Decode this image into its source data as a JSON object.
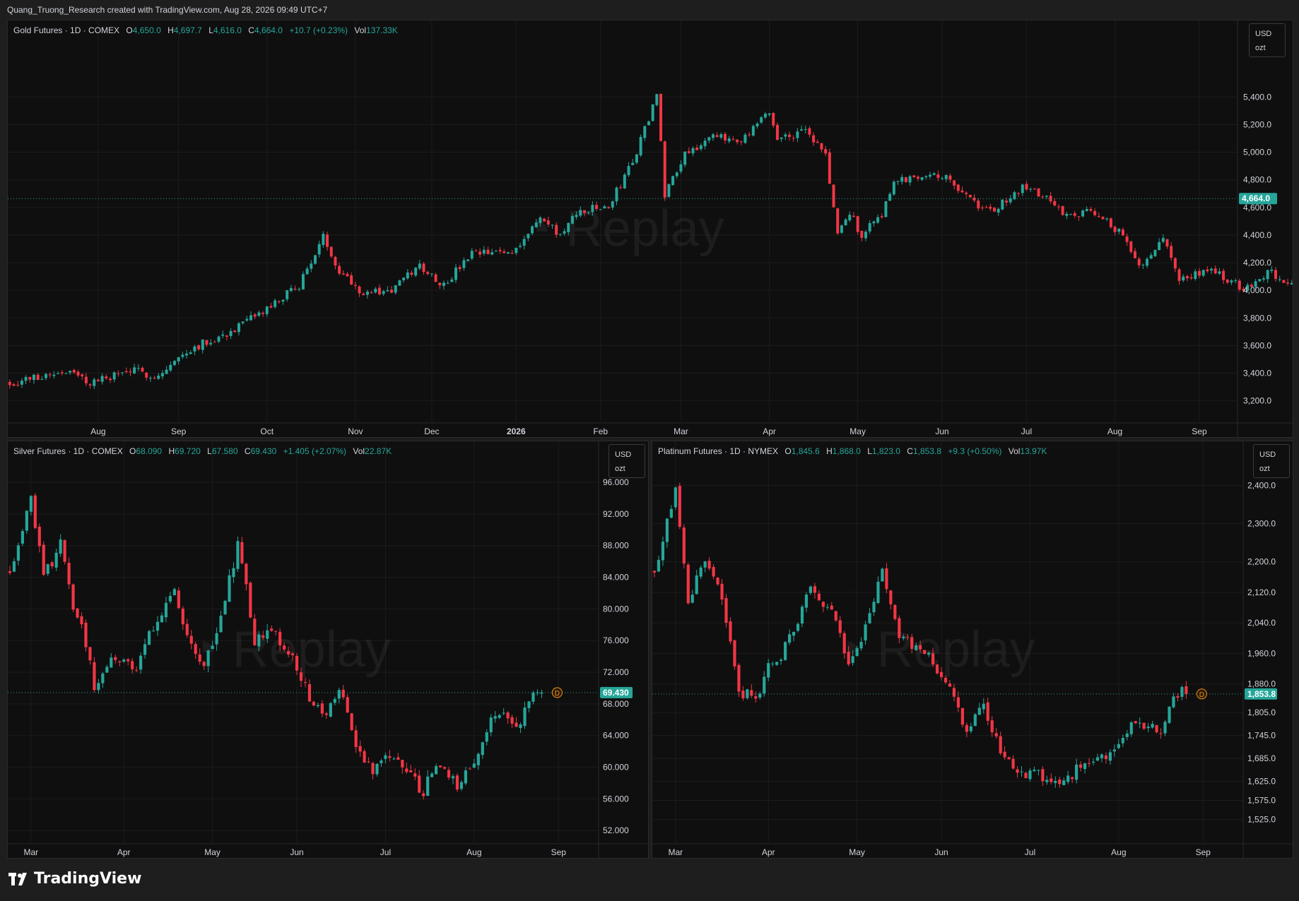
{
  "header": {
    "credit": "Quang_Truong_Research created with TradingView.com, Aug 28, 2026 09:49 UTC+7"
  },
  "footer": {
    "brand": "TradingView"
  },
  "colors": {
    "up": "#26a69a",
    "down": "#f23645",
    "background": "#0f0f0f",
    "grid": "#1c1c1c",
    "marker": "#f7931a"
  },
  "chart_data": [
    {
      "id": "gold",
      "type": "candlestick",
      "title": "Gold Futures · 1D · COMEX",
      "ohlc": {
        "o": "4,650.0",
        "h": "4,697.7",
        "l": "4,616.0",
        "c": "4,664.0",
        "chg": "+10.7 (+0.23%)",
        "vol": "137.33K"
      },
      "unit_box": [
        "USD",
        "ozt"
      ],
      "last_price": "4,664.0",
      "last_value": 4664,
      "ylim": [
        3050,
        5800
      ],
      "y_ticks": [
        {
          "v": 3200,
          "t": "3,200.0"
        },
        {
          "v": 3400,
          "t": "3,400.0"
        },
        {
          "v": 3600,
          "t": "3,600.0"
        },
        {
          "v": 3800,
          "t": "3,800.0"
        },
        {
          "v": 4000,
          "t": "4,000.0"
        },
        {
          "v": 4200,
          "t": "4,200.0"
        },
        {
          "v": 4400,
          "t": "4,400.0"
        },
        {
          "v": 4600,
          "t": "4,600.0"
        },
        {
          "v": 4800,
          "t": "4,800.0"
        },
        {
          "v": 5000,
          "t": "5,000.0"
        },
        {
          "v": 5200,
          "t": "5,200.0"
        },
        {
          "v": 5400,
          "t": "5,400.0"
        }
      ],
      "x_ticks": [
        "Aug",
        "Sep",
        "Oct",
        "Nov",
        "Dec",
        "2026",
        "Feb",
        "Mar",
        "Apr",
        "May",
        "Jun",
        "Jul",
        "Aug",
        "Sep"
      ],
      "x_tick_index": [
        22,
        42,
        64,
        86,
        105,
        126,
        147,
        167,
        189,
        211,
        232,
        253,
        275,
        296
      ],
      "n_slots": 306,
      "series": [
        [
          0,
          3330
        ],
        [
          14,
          3420
        ],
        [
          20,
          3330
        ],
        [
          30,
          3420
        ],
        [
          37,
          3380
        ],
        [
          45,
          3580
        ],
        [
          55,
          3700
        ],
        [
          65,
          3880
        ],
        [
          72,
          4040
        ],
        [
          78,
          4380
        ],
        [
          82,
          4150
        ],
        [
          88,
          3980
        ],
        [
          95,
          4000
        ],
        [
          102,
          4180
        ],
        [
          108,
          4040
        ],
        [
          115,
          4260
        ],
        [
          125,
          4280
        ],
        [
          132,
          4520
        ],
        [
          137,
          4400
        ],
        [
          142,
          4580
        ],
        [
          149,
          4600
        ],
        [
          156,
          5000
        ],
        [
          161,
          5420
        ],
        [
          163,
          4700
        ],
        [
          168,
          5000
        ],
        [
          175,
          5100
        ],
        [
          183,
          5100
        ],
        [
          189,
          5290
        ],
        [
          191,
          5100
        ],
        [
          198,
          5150
        ],
        [
          203,
          4980
        ],
        [
          206,
          4400
        ],
        [
          209,
          4560
        ],
        [
          212,
          4400
        ],
        [
          217,
          4560
        ],
        [
          220,
          4780
        ],
        [
          230,
          4860
        ],
        [
          236,
          4750
        ],
        [
          241,
          4600
        ],
        [
          245,
          4580
        ],
        [
          252,
          4740
        ],
        [
          258,
          4680
        ],
        [
          262,
          4560
        ],
        [
          271,
          4560
        ],
        [
          276,
          4420
        ],
        [
          281,
          4180
        ],
        [
          287,
          4380
        ],
        [
          291,
          4080
        ],
        [
          299,
          4140
        ],
        [
          307,
          4020
        ],
        [
          314,
          4140
        ],
        [
          318,
          4020
        ],
        [
          322,
          4180
        ],
        [
          326,
          4380
        ],
        [
          331,
          4480
        ],
        [
          336,
          4600
        ],
        [
          340,
          4700
        ],
        [
          345,
          4664
        ]
      ],
      "up_to_index": 345
    },
    {
      "id": "silver",
      "type": "candlestick",
      "title": "Silver Futures · 1D · COMEX",
      "ohlc": {
        "o": "68.090",
        "h": "69.720",
        "l": "67.580",
        "c": "69.430",
        "chg": "+1.405 (+2.07%)",
        "vol": "22.87K"
      },
      "unit_box": [
        "USD",
        "ozt"
      ],
      "last_price": "69.430",
      "last_value": 69.43,
      "ylim": [
        50.5,
        98.5
      ],
      "y_ticks": [
        {
          "v": 52,
          "t": "52.000"
        },
        {
          "v": 56,
          "t": "56.000"
        },
        {
          "v": 60,
          "t": "60.000"
        },
        {
          "v": 64,
          "t": "64.000"
        },
        {
          "v": 68,
          "t": "68.000"
        },
        {
          "v": 72,
          "t": "72.000"
        },
        {
          "v": 76,
          "t": "76.000"
        },
        {
          "v": 80,
          "t": "80.000"
        },
        {
          "v": 84,
          "t": "84.000"
        },
        {
          "v": 88,
          "t": "88.000"
        },
        {
          "v": 92,
          "t": "92.000"
        },
        {
          "v": 96,
          "t": "96.000"
        }
      ],
      "x_ticks": [
        "Mar",
        "Apr",
        "May",
        "Jun",
        "Jul",
        "Aug",
        "Sep"
      ],
      "x_tick_index": [
        5,
        27,
        48,
        68,
        89,
        110,
        130
      ],
      "n_slots": 140,
      "series": [
        [
          0,
          85
        ],
        [
          5,
          94
        ],
        [
          8,
          84
        ],
        [
          12,
          88
        ],
        [
          15,
          80
        ],
        [
          18,
          76
        ],
        [
          20,
          70
        ],
        [
          24,
          73
        ],
        [
          27,
          74
        ],
        [
          30,
          72
        ],
        [
          34,
          78
        ],
        [
          37,
          80
        ],
        [
          39,
          82
        ],
        [
          42,
          77
        ],
        [
          46,
          73
        ],
        [
          50,
          79
        ],
        [
          54,
          88
        ],
        [
          55,
          86
        ],
        [
          58,
          76
        ],
        [
          62,
          77
        ],
        [
          66,
          75
        ],
        [
          70,
          70
        ],
        [
          74,
          66
        ],
        [
          78,
          70
        ],
        [
          82,
          63
        ],
        [
          86,
          59
        ],
        [
          90,
          62
        ],
        [
          94,
          59
        ],
        [
          98,
          57
        ],
        [
          101,
          60
        ],
        [
          106,
          58
        ],
        [
          110,
          61
        ],
        [
          113,
          65
        ],
        [
          117,
          67
        ],
        [
          120,
          65
        ],
        [
          124,
          69
        ],
        [
          126,
          69.43
        ]
      ],
      "up_to_index": 126
    },
    {
      "id": "platinum",
      "type": "candlestick",
      "title": "Platinum Futures · 1D · NYMEX",
      "ohlc": {
        "o": "1,845.6",
        "h": "1,868.0",
        "l": "1,823.0",
        "c": "1,853.8",
        "chg": "+9.3 (+0.50%)",
        "vol": "13.97K"
      },
      "unit_box": [
        "USD",
        "ozt"
      ],
      "last_price": "1,853.8",
      "last_value": 1853.8,
      "ylim": [
        1465,
        2460
      ],
      "y_ticks": [
        {
          "v": 1525,
          "t": "1,525.0"
        },
        {
          "v": 1575,
          "t": "1,575.0"
        },
        {
          "v": 1625,
          "t": "1,625.0"
        },
        {
          "v": 1685,
          "t": "1,685.0"
        },
        {
          "v": 1745,
          "t": "1,745.0"
        },
        {
          "v": 1805,
          "t": "1,805.0"
        },
        {
          "v": 1880,
          "t": "1,880.0"
        },
        {
          "v": 1960,
          "t": "1,960.0"
        },
        {
          "v": 2040,
          "t": "2,040.0"
        },
        {
          "v": 2120,
          "t": "2,120.0"
        },
        {
          "v": 2200,
          "t": "2,200.0"
        },
        {
          "v": 2300,
          "t": "2,300.0"
        },
        {
          "v": 2400,
          "t": "2,400.0"
        }
      ],
      "x_ticks": [
        "Mar",
        "Apr",
        "May",
        "Jun",
        "Jul",
        "Aug",
        "Sep"
      ],
      "x_tick_index": [
        5,
        27,
        48,
        68,
        89,
        110,
        130
      ],
      "n_slots": 140,
      "series": [
        [
          0,
          2180
        ],
        [
          5,
          2380
        ],
        [
          8,
          2100
        ],
        [
          12,
          2200
        ],
        [
          15,
          2150
        ],
        [
          18,
          2000
        ],
        [
          20,
          1860
        ],
        [
          24,
          1840
        ],
        [
          27,
          1920
        ],
        [
          30,
          1960
        ],
        [
          34,
          2050
        ],
        [
          37,
          2140
        ],
        [
          39,
          2110
        ],
        [
          42,
          2060
        ],
        [
          46,
          1940
        ],
        [
          50,
          2020
        ],
        [
          54,
          2180
        ],
        [
          55,
          2140
        ],
        [
          58,
          2000
        ],
        [
          62,
          1980
        ],
        [
          66,
          1940
        ],
        [
          70,
          1860
        ],
        [
          74,
          1760
        ],
        [
          78,
          1820
        ],
        [
          82,
          1700
        ],
        [
          86,
          1640
        ],
        [
          90,
          1650
        ],
        [
          94,
          1610
        ],
        [
          98,
          1640
        ],
        [
          101,
          1660
        ],
        [
          106,
          1680
        ],
        [
          110,
          1730
        ],
        [
          113,
          1780
        ],
        [
          117,
          1770
        ],
        [
          120,
          1750
        ],
        [
          124,
          1860
        ],
        [
          126,
          1853.8
        ]
      ],
      "up_to_index": 126
    }
  ]
}
